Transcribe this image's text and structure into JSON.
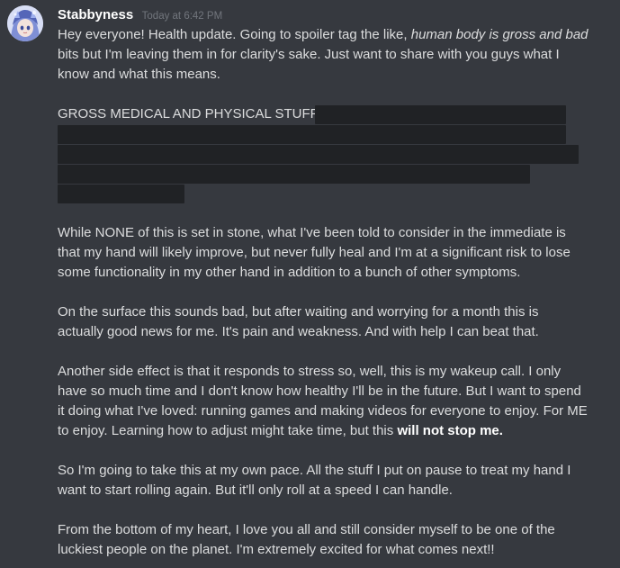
{
  "message": {
    "username": "Stabbyness",
    "timestamp": "Today at 6:42 PM",
    "intro_text": "Hey everyone! Health update. Going to spoiler tag the like, ",
    "intro_italic": "human body is gross and bad",
    "intro_rest_1": "bits but I'm leaving them in for clarity's sake. Just want to share with you guys what I",
    "intro_rest_2": "know and what this means.",
    "spoiler_heading": "GROSS MEDICAL AND PHYSICAL STUFF: ",
    "para_1": [
      "While NONE of this is set in stone, what I've been told to consider in the immediate is",
      "that my hand will likely improve, but never fully heal and I'm at a significant risk to lose",
      "some functionality in my other hand in addition to a bunch of other symptoms."
    ],
    "para_2": [
      "On the surface this sounds bad, but after waiting and worrying for a month this is",
      "actually good news for me. It's pain and weakness. And with help I can beat that."
    ],
    "para_3": [
      "Another side effect is that it responds to stress so, well, this is my wakeup call. I only",
      "have so much time and I don't know how healthy I'll be in the future. But I want to spend",
      "it doing what I've loved: running games and making videos for everyone to enjoy. For ME"
    ],
    "para_3_last_text": "to enjoy. Learning how to adjust might take time, but this ",
    "para_3_last_bold": "will not stop me.",
    "para_4": [
      "So I'm going to take this at my own pace. All the stuff I put on pause to treat my hand I",
      "want to start rolling again. But it'll only roll at a speed I can handle."
    ],
    "para_5": [
      "From the bottom of my heart, I love you all and still consider myself to be one of the",
      "luckiest people on the planet. I'm extremely excited for what comes next!!"
    ]
  },
  "colors": {
    "background": "#36393f",
    "text": "#dcddde",
    "username": "#ffffff",
    "timestamp": "#72767d",
    "spoiler": "#202225"
  },
  "icons": {
    "avatar": "anime-character-avatar"
  }
}
